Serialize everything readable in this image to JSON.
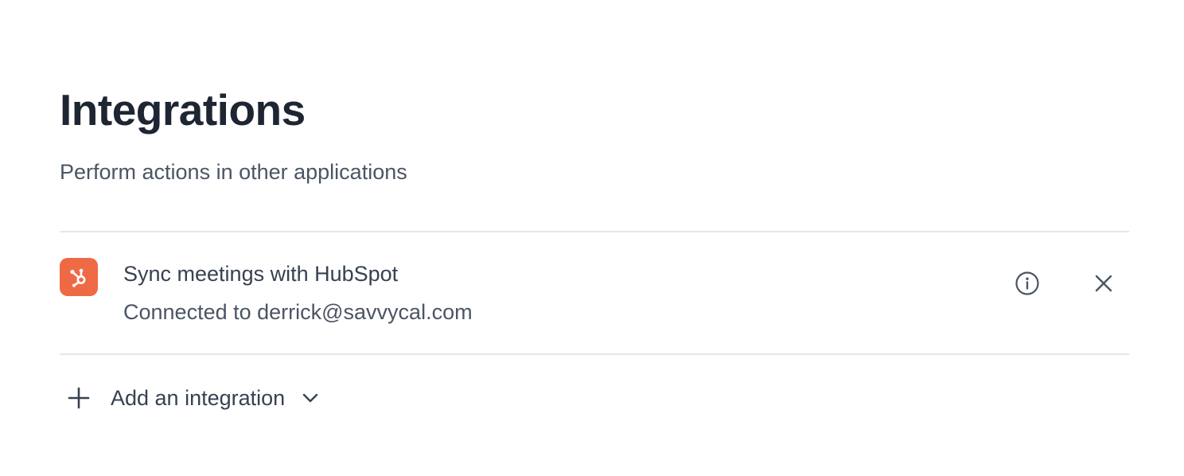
{
  "header": {
    "title": "Integrations",
    "subtitle": "Perform actions in other applications"
  },
  "integrations": [
    {
      "icon": "hubspot-logo-icon",
      "title": "Sync meetings with HubSpot",
      "status": "Connected to derrick@savvycal.com",
      "brand_color": "#ee6a45",
      "actions": [
        "info-icon",
        "close-icon"
      ]
    }
  ],
  "add_integration": {
    "label": "Add an integration",
    "icons": [
      "plus-icon",
      "chevron-down-icon"
    ]
  },
  "colors": {
    "title": "#1e2533",
    "text": "#374151",
    "muted": "#4b5563",
    "divider": "#e5e7eb",
    "hubspot": "#ee6a45"
  }
}
